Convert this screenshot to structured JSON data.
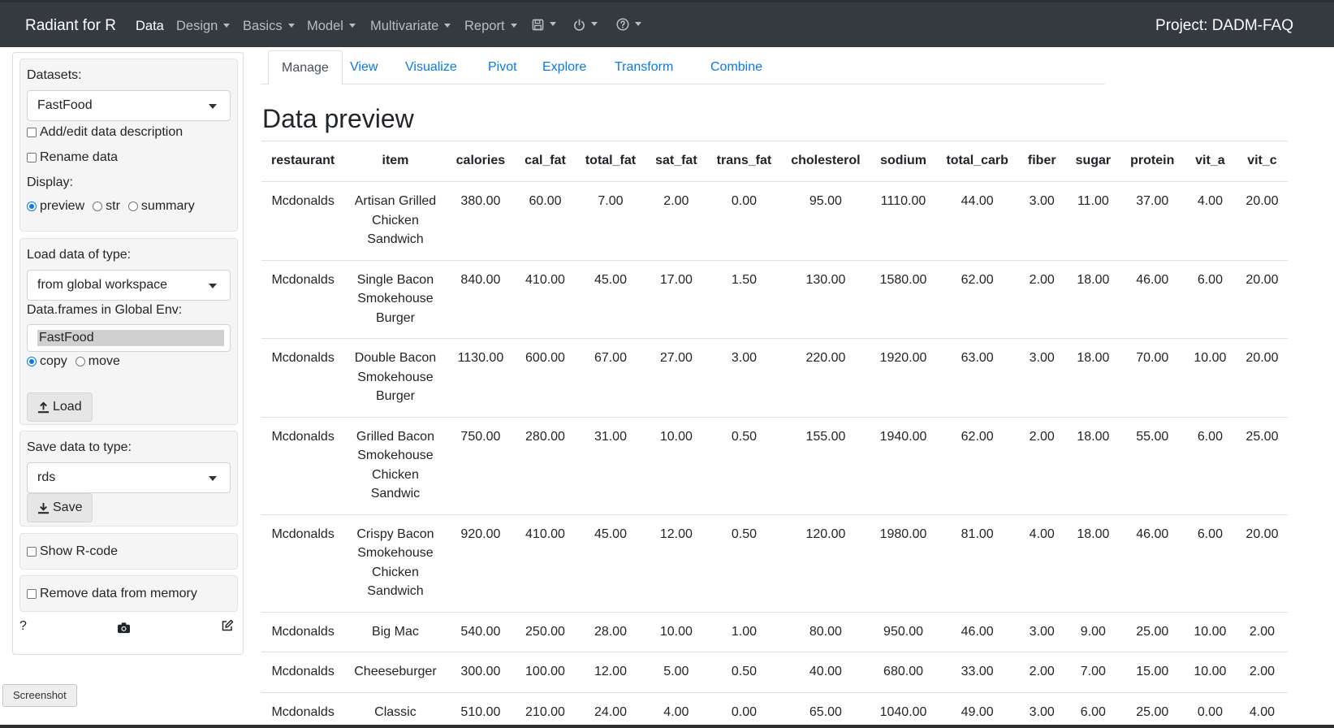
{
  "navbar": {
    "brand": "Radiant for R",
    "items": [
      {
        "label": "Data"
      },
      {
        "label": "Design"
      },
      {
        "label": "Basics"
      },
      {
        "label": "Model"
      },
      {
        "label": "Multivariate"
      },
      {
        "label": "Report"
      }
    ],
    "icons": [
      "save-icon",
      "power-icon",
      "help-icon"
    ],
    "project": "Project: DADM-FAQ"
  },
  "sidebar": {
    "datasets_label": "Datasets:",
    "dataset_selected": "FastFood",
    "add_edit_description": "Add/edit data description",
    "rename_data": "Rename data",
    "display_label": "Display:",
    "display_options": [
      "preview",
      "str",
      "summary"
    ],
    "display_selected": "preview",
    "load_type_label": "Load data of type:",
    "load_type_selected": "from global workspace",
    "global_env_label": "Data.frames in Global Env:",
    "global_env_value": "FastFood",
    "copy_move_options": [
      "copy",
      "move"
    ],
    "copy_move_selected": "copy",
    "load_button": "Load",
    "save_type_label": "Save data to type:",
    "save_type_selected": "rds",
    "save_button": "Save",
    "show_rcode": "Show R-code",
    "remove_data": "Remove data from memory",
    "help_text": "?"
  },
  "tabs": [
    "Manage",
    "View",
    "Visualize",
    "Pivot",
    "Explore",
    "Transform",
    "Combine"
  ],
  "active_tab": "Manage",
  "main": {
    "title": "Data preview",
    "columns": [
      "restaurant",
      "item",
      "calories",
      "cal_fat",
      "total_fat",
      "sat_fat",
      "trans_fat",
      "cholesterol",
      "sodium",
      "total_carb",
      "fiber",
      "sugar",
      "protein",
      "vit_a",
      "vit_c"
    ],
    "rows": [
      [
        "Mcdonalds",
        "Artisan Grilled Chicken Sandwich",
        "380.00",
        "60.00",
        "7.00",
        "2.00",
        "0.00",
        "95.00",
        "1110.00",
        "44.00",
        "3.00",
        "11.00",
        "37.00",
        "4.00",
        "20.00"
      ],
      [
        "Mcdonalds",
        "Single Bacon Smokehouse Burger",
        "840.00",
        "410.00",
        "45.00",
        "17.00",
        "1.50",
        "130.00",
        "1580.00",
        "62.00",
        "2.00",
        "18.00",
        "46.00",
        "6.00",
        "20.00"
      ],
      [
        "Mcdonalds",
        "Double Bacon Smokehouse Burger",
        "1130.00",
        "600.00",
        "67.00",
        "27.00",
        "3.00",
        "220.00",
        "1920.00",
        "63.00",
        "3.00",
        "18.00",
        "70.00",
        "10.00",
        "20.00"
      ],
      [
        "Mcdonalds",
        "Grilled Bacon Smokehouse Chicken Sandwic",
        "750.00",
        "280.00",
        "31.00",
        "10.00",
        "0.50",
        "155.00",
        "1940.00",
        "62.00",
        "2.00",
        "18.00",
        "55.00",
        "6.00",
        "25.00"
      ],
      [
        "Mcdonalds",
        "Crispy Bacon Smokehouse Chicken Sandwich",
        "920.00",
        "410.00",
        "45.00",
        "12.00",
        "0.50",
        "120.00",
        "1980.00",
        "81.00",
        "4.00",
        "18.00",
        "46.00",
        "6.00",
        "20.00"
      ],
      [
        "Mcdonalds",
        "Big Mac",
        "540.00",
        "250.00",
        "28.00",
        "10.00",
        "1.00",
        "80.00",
        "950.00",
        "46.00",
        "3.00",
        "9.00",
        "25.00",
        "10.00",
        "2.00"
      ],
      [
        "Mcdonalds",
        "Cheeseburger",
        "300.00",
        "100.00",
        "12.00",
        "5.00",
        "0.50",
        "40.00",
        "680.00",
        "33.00",
        "2.00",
        "7.00",
        "15.00",
        "10.00",
        "2.00"
      ],
      [
        "Mcdonalds",
        "Classic",
        "510.00",
        "210.00",
        "24.00",
        "4.00",
        "0.00",
        "65.00",
        "1040.00",
        "49.00",
        "3.00",
        "6.00",
        "25.00",
        "0.00",
        "4.00"
      ]
    ]
  },
  "screenshot_label": "Screenshot",
  "colors": {
    "navbar_bg": "#343a40",
    "link": "#0b7ae5",
    "well_bg": "#f5f5f5"
  }
}
